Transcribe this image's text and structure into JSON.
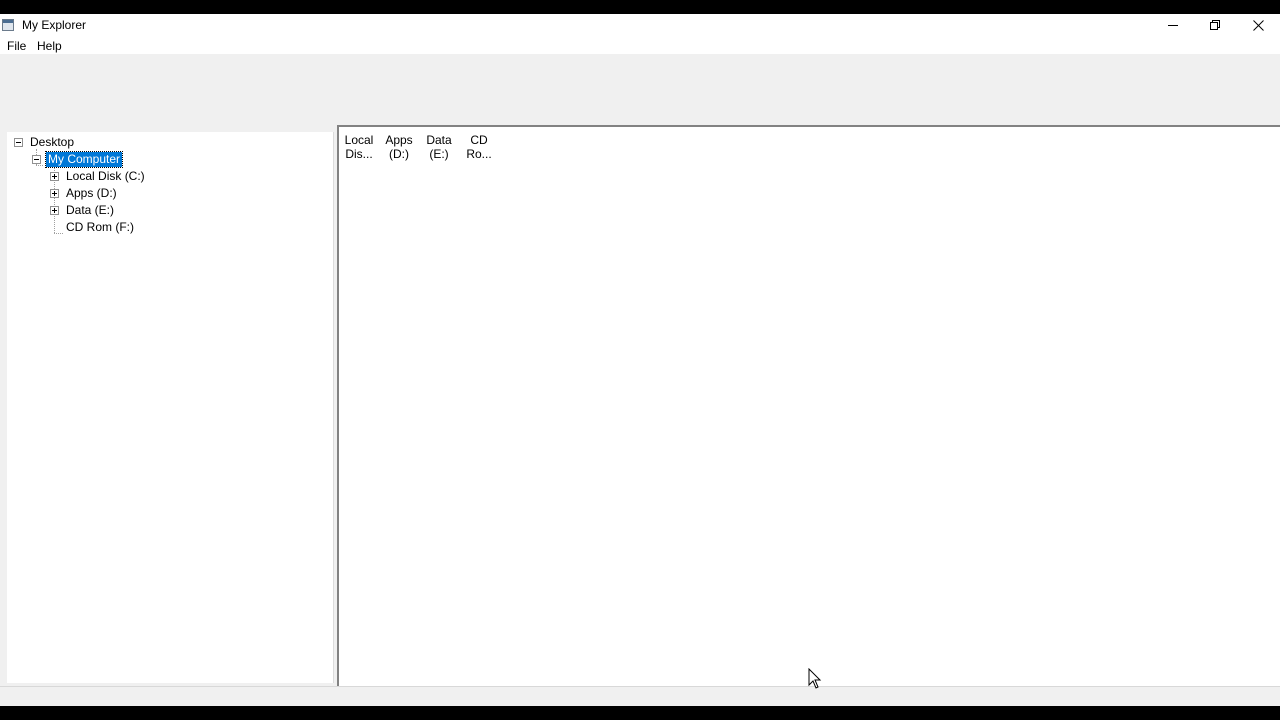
{
  "window": {
    "title": "My Explorer"
  },
  "menu": {
    "file": "File",
    "help": "Help"
  },
  "tree": {
    "root": "Desktop",
    "computer": "My Computer",
    "drives": [
      "Local Disk (C:)",
      "Apps (D:)",
      "Data (E:)",
      "CD Rom (F:)"
    ]
  },
  "list": {
    "items": [
      {
        "line1": "Local",
        "line2": "Dis..."
      },
      {
        "line1": "Apps",
        "line2": "(D:)"
      },
      {
        "line1": "Data",
        "line2": "(E:)"
      },
      {
        "line1": "CD",
        "line2": "Ro..."
      }
    ]
  },
  "colors": {
    "selection": "#0078d7",
    "chrome": "#f0f0f0"
  }
}
